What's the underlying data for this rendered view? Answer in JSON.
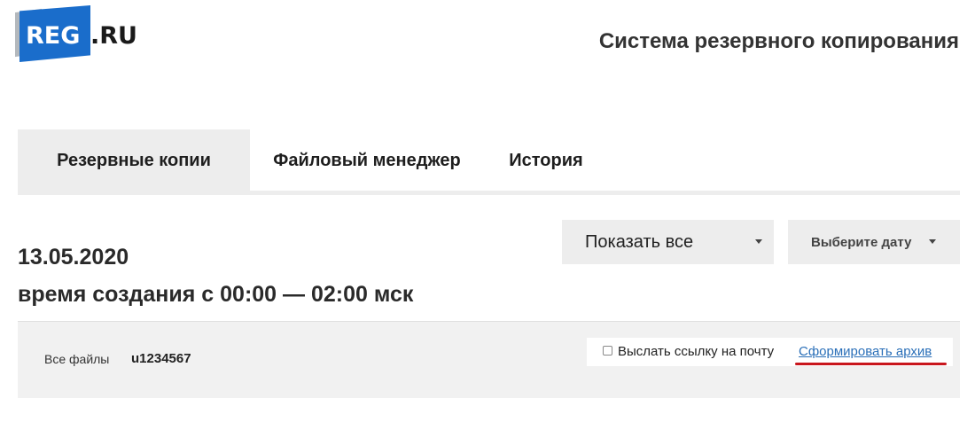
{
  "brand": {
    "logo_primary": "REG",
    "logo_secondary": ".RU",
    "colors": {
      "brand_blue": "#1a6dcb",
      "link_blue": "#2a6fb8",
      "highlight_red": "#c9161d",
      "panel_gray": "#ededed"
    }
  },
  "header": {
    "title": "Система резервного копирования"
  },
  "tabs": [
    {
      "label": "Резервные копии",
      "active": true
    },
    {
      "label": "Файловый менеджер",
      "active": false
    },
    {
      "label": "История",
      "active": false
    }
  ],
  "backup": {
    "date": "13.05.2020",
    "time_range": "время создания с 00:00 — 02:00 мск"
  },
  "filters": {
    "show_select": {
      "value": "Показать все",
      "icon": "chevron-down-icon"
    },
    "date_select": {
      "value": "Выберите дату",
      "icon": "chevron-down-icon"
    }
  },
  "files": {
    "label": "Все файлы",
    "user": "u1234567",
    "send_link_checkbox": {
      "label": "Выслать ссылку на почту",
      "checked": false
    },
    "archive_link": "Сформировать архив"
  }
}
